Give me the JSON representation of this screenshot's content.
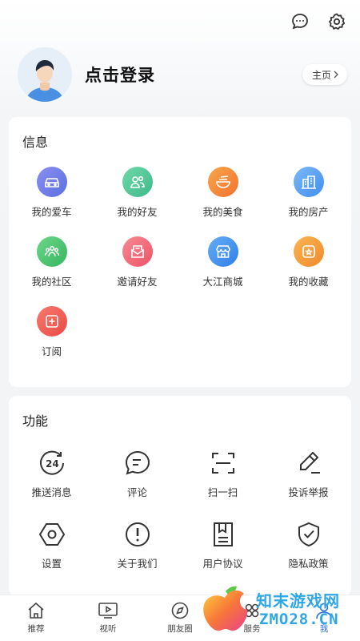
{
  "header": {
    "message_icon": "message-icon",
    "settings_icon": "gear-icon"
  },
  "profile": {
    "login_text": "点击登录",
    "homepage_label": "主页"
  },
  "info_section": {
    "title": "信息",
    "items": [
      {
        "label": "我的爱车",
        "icon": "car-icon",
        "color": "#6f7fe6"
      },
      {
        "label": "我的好友",
        "icon": "friends-icon",
        "color": "#4fc59a"
      },
      {
        "label": "我的美食",
        "icon": "food-bowl-icon",
        "color": "#f5883a"
      },
      {
        "label": "我的房产",
        "icon": "building-icon",
        "color": "#5aa0f0"
      },
      {
        "label": "我的社区",
        "icon": "community-icon",
        "color": "#4cc26f"
      },
      {
        "label": "邀请好友",
        "icon": "invite-mail-icon",
        "color": "#f06a78"
      },
      {
        "label": "大江商城",
        "icon": "store-icon",
        "color": "#4596f2"
      },
      {
        "label": "我的收藏",
        "icon": "favorite-icon",
        "color": "#f59a3c"
      },
      {
        "label": "订阅",
        "icon": "subscribe-icon",
        "color": "#f05a50"
      }
    ]
  },
  "function_section": {
    "title": "功能",
    "items": [
      {
        "label": "推送消息",
        "icon": "push-24-icon"
      },
      {
        "label": "评论",
        "icon": "comment-icon"
      },
      {
        "label": "扫一扫",
        "icon": "scan-icon"
      },
      {
        "label": "投诉举报",
        "icon": "pen-report-icon"
      },
      {
        "label": "设置",
        "icon": "hexagon-settings-icon"
      },
      {
        "label": "关于我们",
        "icon": "about-info-icon"
      },
      {
        "label": "用户协议",
        "icon": "agreement-doc-icon"
      },
      {
        "label": "隐私政策",
        "icon": "shield-check-icon"
      }
    ]
  },
  "tabbar": {
    "tabs": [
      {
        "label": "推荐",
        "icon": "home-icon"
      },
      {
        "label": "视听",
        "icon": "tv-play-icon"
      },
      {
        "label": "朋友圈",
        "icon": "compass-icon"
      },
      {
        "label": "服务",
        "icon": "service-icon"
      },
      {
        "label": "我",
        "icon": "user-icon"
      }
    ],
    "active": "我"
  },
  "watermark": {
    "line1": "知末游戏网",
    "line2": "ZMO28.CN"
  },
  "colors": {
    "accent": "#2a6ed6",
    "watermark": "#2fa6e6"
  }
}
